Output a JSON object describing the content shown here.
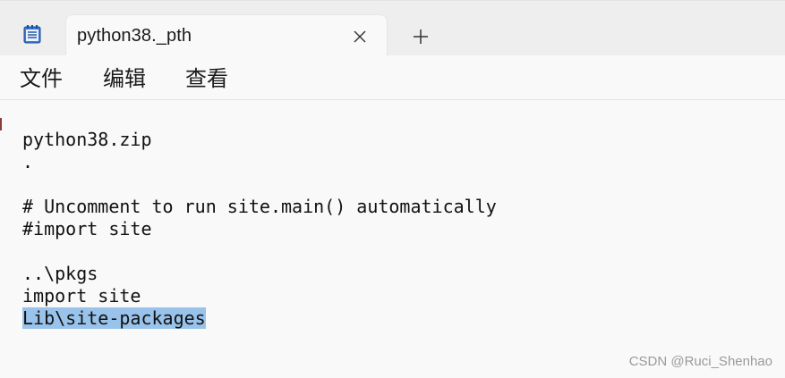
{
  "tab": {
    "title": "python38._pth",
    "close_icon": "close-icon",
    "new_tab_icon": "plus-icon"
  },
  "app_icon": "notepad-icon",
  "menu": {
    "file": "文件",
    "edit": "编辑",
    "view": "查看"
  },
  "editor": {
    "lines": [
      "python38.zip",
      ".",
      "",
      "# Uncomment to run site.main() automatically",
      "#import site",
      "",
      "..\\pkgs",
      "import site",
      "Lib\\site-packages"
    ],
    "selected_line_index": 8,
    "selection_color": "#99c3ea"
  },
  "watermark": "CSDN @Ruci_Shenhao"
}
